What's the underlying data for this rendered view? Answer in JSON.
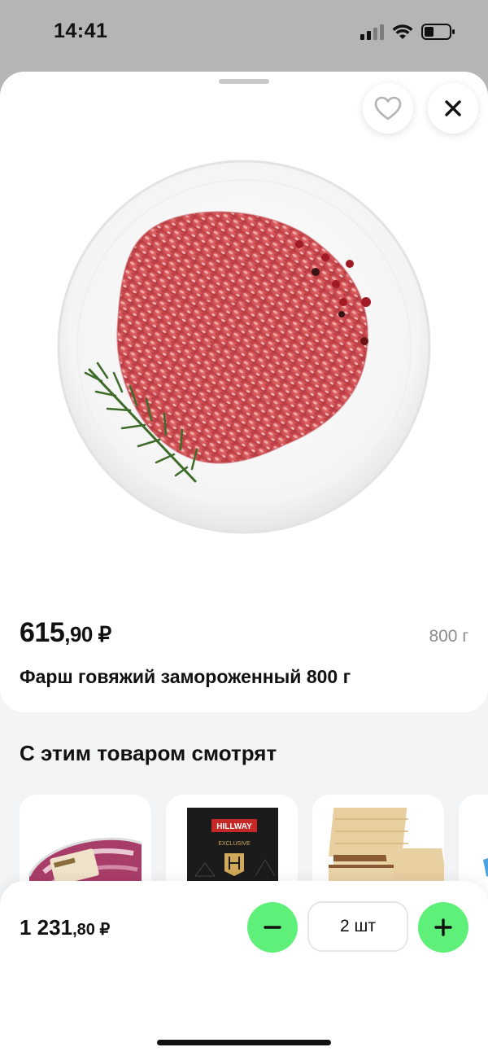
{
  "status_bar": {
    "time": "14:41"
  },
  "product": {
    "price_rub": "615",
    "price_kop": ",90 ₽",
    "weight": "800 г",
    "title": "Фарш говяжий замороженный 800 г",
    "image_icon": "minced-meat-on-plate"
  },
  "actions": {
    "favorite_icon": "heart-icon",
    "close_icon": "close-icon"
  },
  "related": {
    "title": "С этим товаром смотрят",
    "items": [
      {
        "icon": "meat-pack-image"
      },
      {
        "icon": "tea-box-image",
        "brand": "HILLWAY",
        "subtitle": "EXCLUSIVE"
      },
      {
        "icon": "wafers-image"
      },
      {
        "icon": "partial-product-image"
      }
    ]
  },
  "cart": {
    "total_rub": "1 231",
    "total_kop": ",80 ₽",
    "quantity": "2 шт"
  },
  "colors": {
    "accent": "#5ff07a",
    "sheet_bg": "#f3f4f6",
    "status_bg": "#b5b5b5"
  }
}
